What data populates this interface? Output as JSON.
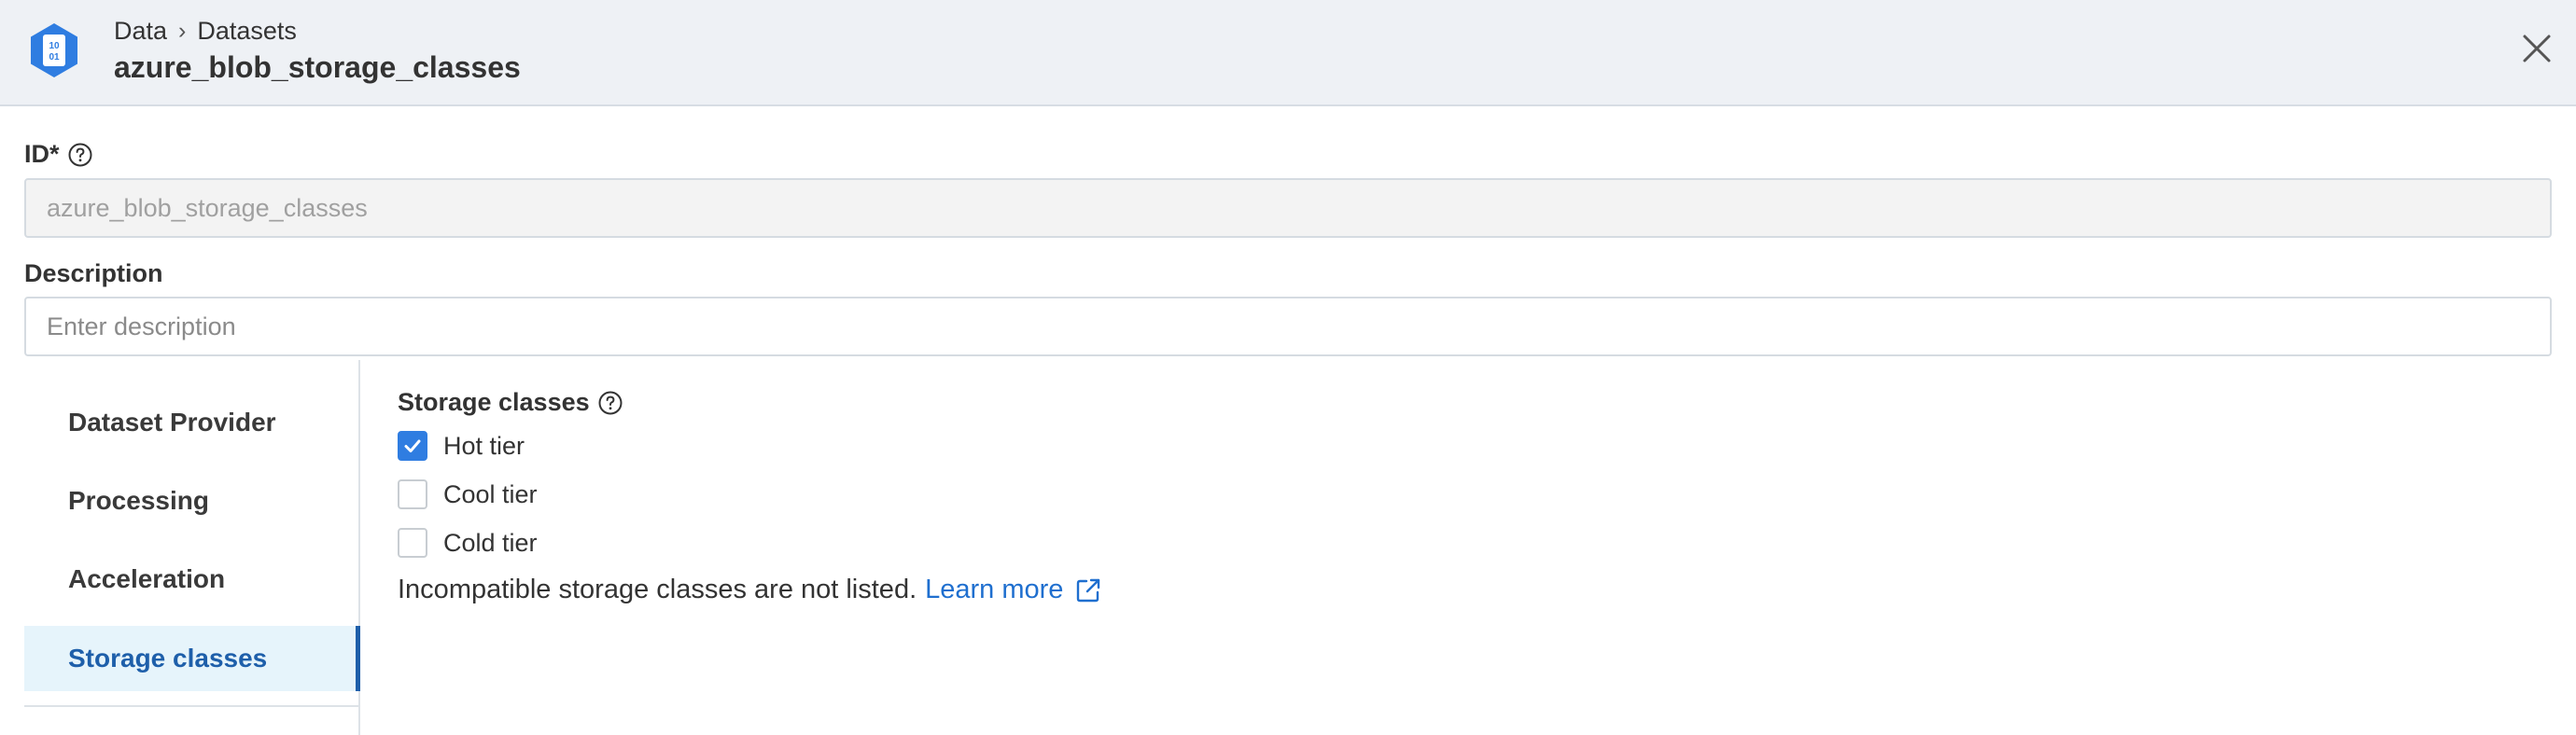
{
  "header": {
    "breadcrumb": [
      "Data",
      "Datasets"
    ],
    "breadcrumb_separator": "›",
    "title": "azure_blob_storage_classes",
    "logo_text_top": "10",
    "logo_text_bottom": "01",
    "icons": {
      "logo": "dataset-hexagon-icon",
      "close": "close-icon"
    }
  },
  "form": {
    "id_label": "ID*",
    "id_value": "azure_blob_storage_classes",
    "description_label": "Description",
    "description_value": "",
    "description_placeholder": "Enter description"
  },
  "side_nav": {
    "items": [
      {
        "label": "Dataset Provider",
        "active": false
      },
      {
        "label": "Processing",
        "active": false
      },
      {
        "label": "Acceleration",
        "active": false
      },
      {
        "label": "Storage classes",
        "active": true
      }
    ]
  },
  "storage": {
    "label": "Storage classes",
    "options": [
      {
        "label": "Hot tier",
        "checked": true
      },
      {
        "label": "Cool tier",
        "checked": false
      },
      {
        "label": "Cold tier",
        "checked": false
      }
    ],
    "note": "Incompatible storage classes are not listed.",
    "learn_more": "Learn more"
  },
  "colors": {
    "header_bg": "#eef1f5",
    "accent": "#2f7de1",
    "link": "#1f6fcf",
    "active_nav_bg": "#e6f4fb",
    "active_nav_text": "#1e5faa"
  }
}
